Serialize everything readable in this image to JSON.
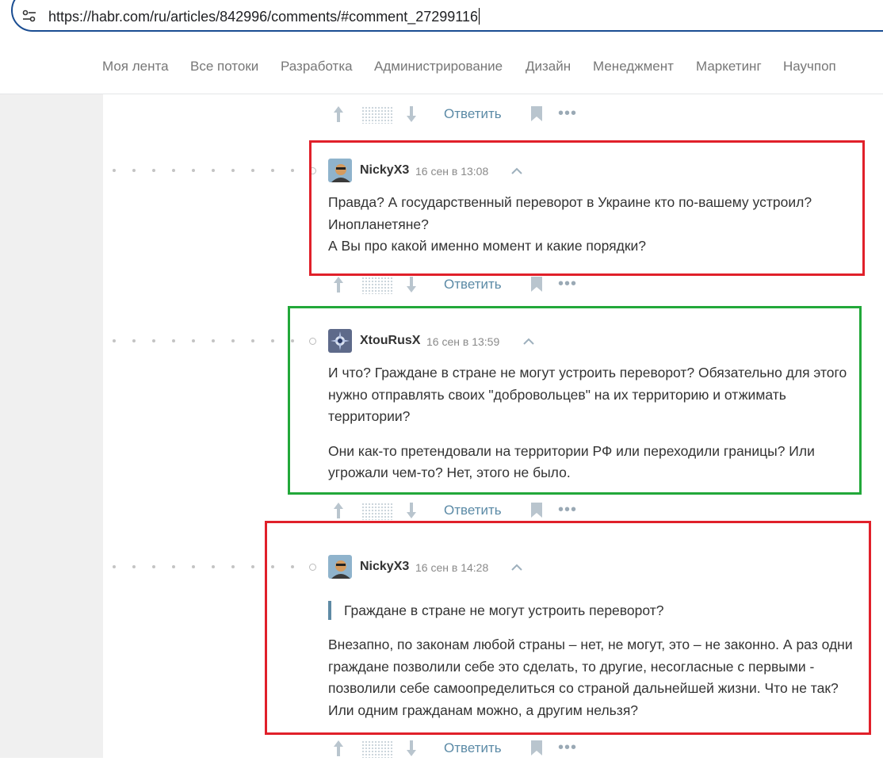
{
  "browser": {
    "url": "https://habr.com/ru/articles/842996/comments/#comment_27299116"
  },
  "nav": {
    "items": [
      "Моя лента",
      "Все потоки",
      "Разработка",
      "Администрирование",
      "Дизайн",
      "Менеджмент",
      "Маркетинг",
      "Научпоп"
    ]
  },
  "actions": {
    "reply_label": "Ответить",
    "more_label": "•••"
  },
  "comments": [
    {
      "author": "NickyX3",
      "time": "16 сен в 13:08",
      "paragraphs": [
        "Правда? А государственный переворот в Украине кто по-вашему устроил? Инопланетяне?",
        "А Вы про какой именно момент и какие порядки?"
      ]
    },
    {
      "author": "XtouRusX",
      "time": "16 сен в 13:59",
      "paragraphs": [
        "И что? Граждане в стране не могут устроить переворот? Обязательно для этого нужно отправлять своих \"добровольцев\" на их территорию и отжимать территории?",
        "Они как-то претендовали на территории РФ или переходили границы? Или угрожали чем-то? Нет, этого не было."
      ]
    },
    {
      "author": "NickyX3",
      "time": "16 сен в 14:28",
      "quote": "Граждане в стране не могут устроить переворот?",
      "paragraphs": [
        "Внезапно, по законам любой страны – нет, не могут, это – не законно. А раз одни граждане позволили себе это сделать, то другие, несогласные с первыми - позволили себе самоопределиться со страной дальнейшей жизни. Что не так? Или одним гражданам можно, а другим нельзя?"
      ]
    }
  ],
  "colors": {
    "highlight_red": "#e0202a",
    "highlight_green": "#22a83a",
    "link": "#5b8aa6"
  }
}
